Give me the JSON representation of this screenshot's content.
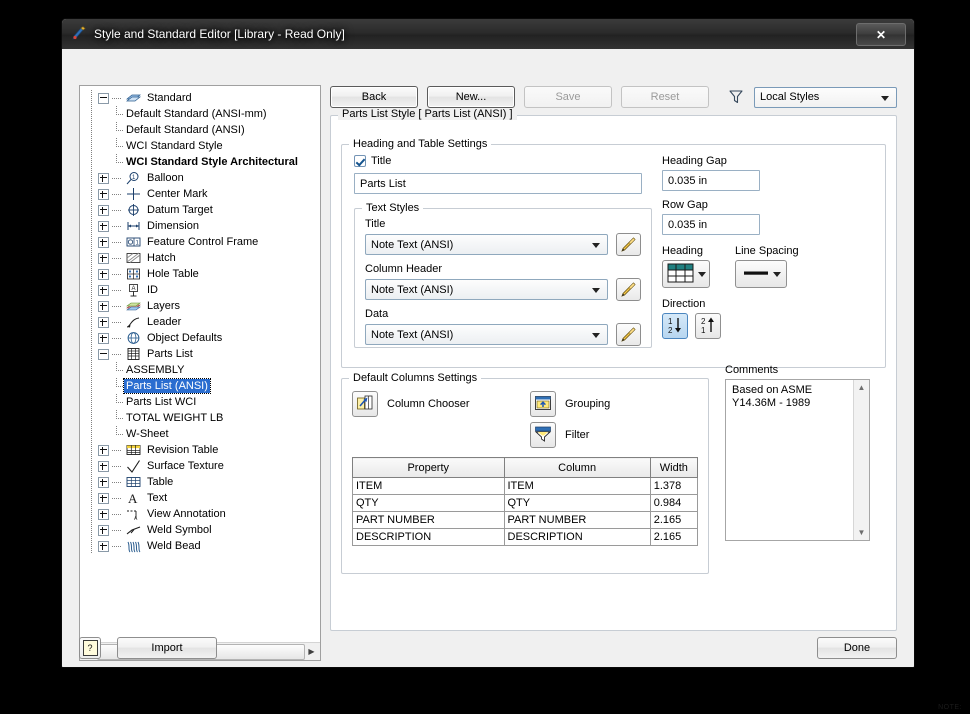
{
  "window": {
    "title": "Style and Standard Editor [Library - Read Only]",
    "close_label": "✕"
  },
  "tree": {
    "items": [
      {
        "label": "Standard",
        "level": 0,
        "expander": "minus",
        "icon": "standard-book-icon"
      },
      {
        "label": "Default Standard (ANSI-mm)",
        "level": 1,
        "expander": "none",
        "icon": "none"
      },
      {
        "label": "Default Standard (ANSI)",
        "level": 1,
        "expander": "none",
        "icon": "none"
      },
      {
        "label": "WCI Standard Style",
        "level": 1,
        "expander": "none",
        "icon": "none"
      },
      {
        "label": "WCI Standard Style Architectural",
        "level": 1,
        "expander": "none",
        "icon": "none",
        "bold": true
      },
      {
        "label": "Balloon",
        "level": 0,
        "expander": "plus",
        "icon": "balloon-icon"
      },
      {
        "label": "Center Mark",
        "level": 0,
        "expander": "plus",
        "icon": "center-mark-icon"
      },
      {
        "label": "Datum Target",
        "level": 0,
        "expander": "plus",
        "icon": "datum-target-icon"
      },
      {
        "label": "Dimension",
        "level": 0,
        "expander": "plus",
        "icon": "dimension-icon"
      },
      {
        "label": "Feature Control Frame",
        "level": 0,
        "expander": "plus",
        "icon": "feature-control-frame-icon"
      },
      {
        "label": "Hatch",
        "level": 0,
        "expander": "plus",
        "icon": "hatch-icon"
      },
      {
        "label": "Hole Table",
        "level": 0,
        "expander": "plus",
        "icon": "hole-table-icon"
      },
      {
        "label": "ID",
        "level": 0,
        "expander": "plus",
        "icon": "id-icon"
      },
      {
        "label": "Layers",
        "level": 0,
        "expander": "plus",
        "icon": "layers-icon"
      },
      {
        "label": "Leader",
        "level": 0,
        "expander": "plus",
        "icon": "leader-icon"
      },
      {
        "label": "Object Defaults",
        "level": 0,
        "expander": "plus",
        "icon": "object-defaults-icon"
      },
      {
        "label": "Parts List",
        "level": 0,
        "expander": "minus",
        "icon": "parts-list-icon"
      },
      {
        "label": "ASSEMBLY",
        "level": 1,
        "expander": "none",
        "icon": "none"
      },
      {
        "label": "Parts List (ANSI)",
        "level": 1,
        "expander": "none",
        "icon": "none",
        "selected": true
      },
      {
        "label": "Parts List WCI",
        "level": 1,
        "expander": "none",
        "icon": "none"
      },
      {
        "label": "TOTAL WEIGHT LB",
        "level": 1,
        "expander": "none",
        "icon": "none"
      },
      {
        "label": "W-Sheet",
        "level": 1,
        "expander": "none",
        "icon": "none"
      },
      {
        "label": "Revision Table",
        "level": 0,
        "expander": "plus",
        "icon": "revision-table-icon"
      },
      {
        "label": "Surface Texture",
        "level": 0,
        "expander": "plus",
        "icon": "surface-texture-icon"
      },
      {
        "label": "Table",
        "level": 0,
        "expander": "plus",
        "icon": "table-icon"
      },
      {
        "label": "Text",
        "level": 0,
        "expander": "plus",
        "icon": "text-icon"
      },
      {
        "label": "View Annotation",
        "level": 0,
        "expander": "plus",
        "icon": "view-annotation-icon"
      },
      {
        "label": "Weld Symbol",
        "level": 0,
        "expander": "plus",
        "icon": "weld-symbol-icon"
      },
      {
        "label": "Weld Bead",
        "level": 0,
        "expander": "plus",
        "icon": "weld-bead-icon"
      }
    ]
  },
  "toolbar": {
    "back": "Back",
    "new": "New...",
    "save": "Save",
    "reset": "Reset",
    "filter_icon": "filter-icon",
    "styles_filter_value": "Local Styles"
  },
  "style_group": {
    "legend": "Parts List Style [ Parts List (ANSI) ]"
  },
  "heading_table": {
    "legend": "Heading and Table Settings",
    "title_checkbox_label": "Title",
    "title_checked": true,
    "title_value": "Parts List",
    "text_styles": {
      "legend": "Text Styles",
      "rows": [
        {
          "label": "Title",
          "value": "Note Text (ANSI)"
        },
        {
          "label": "Column Header",
          "value": "Note Text (ANSI)"
        },
        {
          "label": "Data",
          "value": "Note Text (ANSI)"
        }
      ],
      "edit_icon": "pencil-icon"
    },
    "heading_gap_label": "Heading Gap",
    "heading_gap_value": "0.035 in",
    "row_gap_label": "Row Gap",
    "row_gap_value": "0.035 in",
    "heading_label": "Heading",
    "line_spacing_label": "Line Spacing",
    "direction_label": "Direction",
    "direction_down": "1↓2↓",
    "direction_up": "2↑1↑"
  },
  "columns_settings": {
    "legend": "Default Columns Settings",
    "column_chooser": "Column Chooser",
    "grouping": "Grouping",
    "filter": "Filter",
    "table": {
      "headers": [
        "Property",
        "Column",
        "Width"
      ],
      "rows": [
        [
          "ITEM",
          "ITEM",
          "1.378"
        ],
        [
          "QTY",
          "QTY",
          "0.984"
        ],
        [
          "PART NUMBER",
          "PART NUMBER",
          "2.165"
        ],
        [
          "DESCRIPTION",
          "DESCRIPTION",
          "2.165"
        ]
      ]
    }
  },
  "comments": {
    "label": "Comments",
    "text": "Based on ASME\nY14.36M - 1989"
  },
  "footer": {
    "help": "?",
    "import": "Import",
    "done": "Done"
  },
  "background": {
    "note": "NOTE:"
  },
  "colors": {
    "selection": "#2a6dd0",
    "accent_teal": "#1f8080",
    "icon_yellow": "#ffd24a",
    "window_bg": "#f0f0f0"
  }
}
